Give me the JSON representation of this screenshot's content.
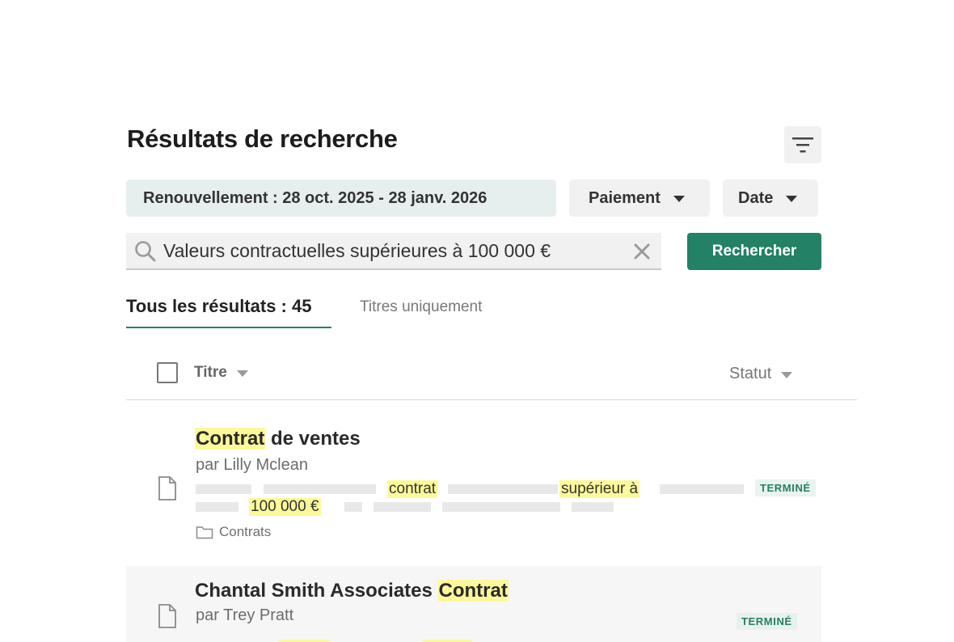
{
  "header": {
    "title": "Résultats de recherche"
  },
  "filters": {
    "renewal": "Renouvellement : 28 oct. 2025 - 28 janv. 2026",
    "payment": "Paiement",
    "date": "Date"
  },
  "search": {
    "value": "Valeurs contractuelles supérieures à 100 000 €",
    "button_label": "Rechercher"
  },
  "tabs": {
    "all": "Tous les résultats : 45",
    "titles_only": "Titres uniquement"
  },
  "table": {
    "col_title": "Titre",
    "col_status": "Statut"
  },
  "results": [
    {
      "title_highlight": "Contrat",
      "title_rest": " de ventes",
      "author": "par Lilly Mclean",
      "snippet": [
        "contrat",
        "supérieur à",
        "100 000 €"
      ],
      "folder": "Contrats",
      "status": "TERMINÉ"
    },
    {
      "title_rest": "Chantal Smith Associates ",
      "title_highlight": "Contrat",
      "author": "par Trey Pratt",
      "status": "TERMINÉ"
    }
  ],
  "colors": {
    "accent": "#238165",
    "highlight": "#fcf99a",
    "renewal_chip": "#e6efee",
    "chip": "#f1f1f1"
  }
}
